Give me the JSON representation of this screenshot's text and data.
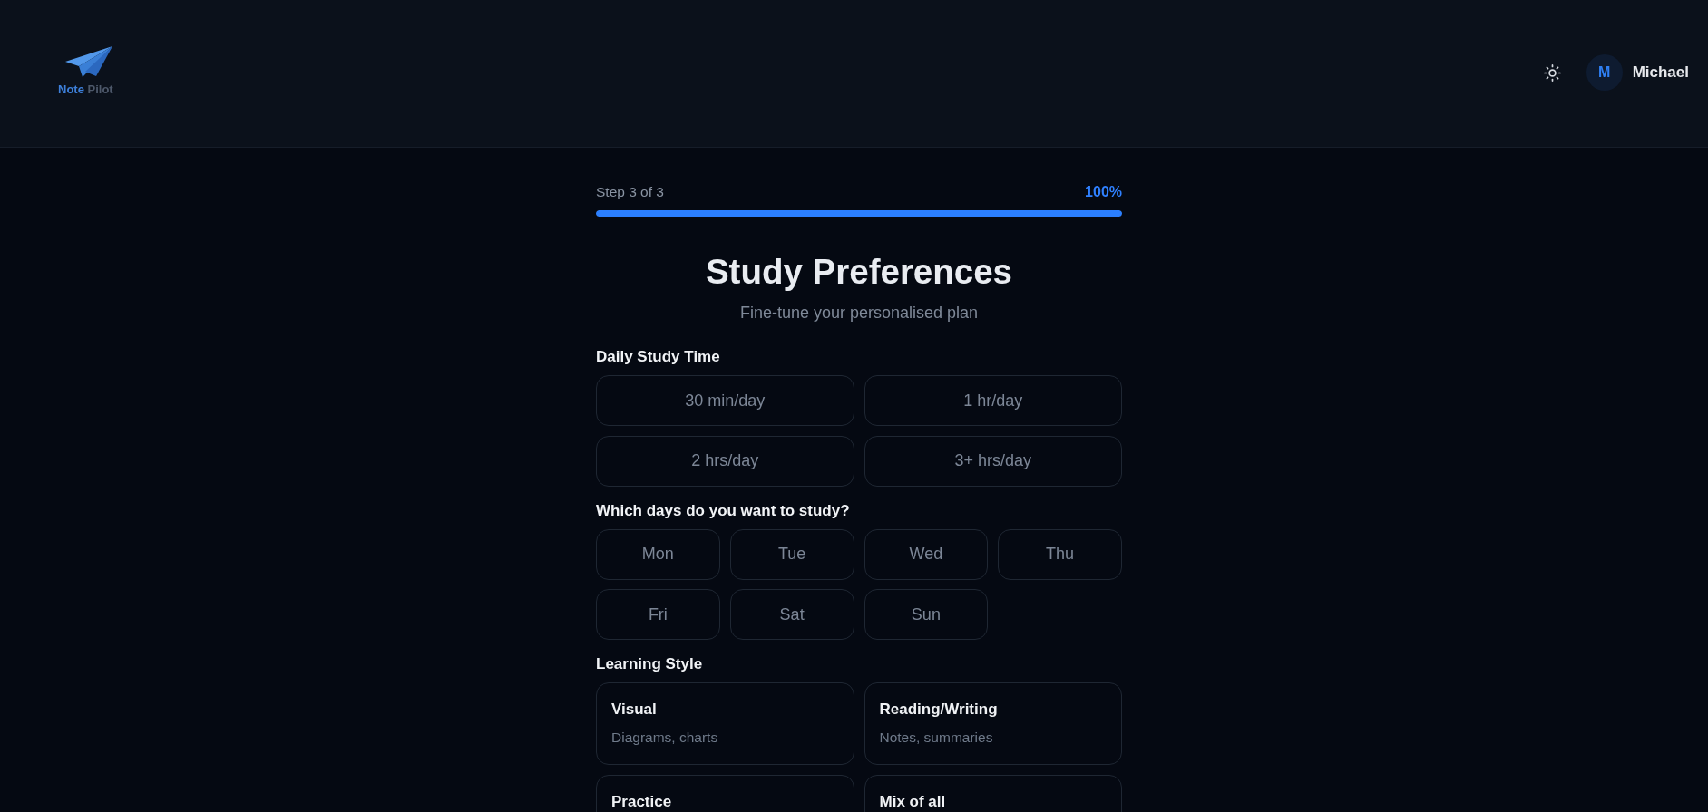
{
  "header": {
    "logo": {
      "primary": "Note",
      "secondary": "Pilot"
    },
    "user": {
      "initial": "M",
      "name": "Michael"
    }
  },
  "progress": {
    "label": "Step 3 of 3",
    "percent": "100%",
    "level": 1.0
  },
  "title": "Study Preferences",
  "subtitle": "Fine-tune your personalised plan",
  "sections": [
    {
      "kind": "time",
      "label": "Daily Study Time",
      "options": [
        {
          "label": "30 min/day",
          "selected": false
        },
        {
          "label": "1 hr/day",
          "selected": false
        },
        {
          "label": "2 hrs/day",
          "selected": false
        },
        {
          "label": "3+ hrs/day",
          "selected": false
        }
      ]
    },
    {
      "kind": "days",
      "label": "Which days do you want to study?",
      "options": [
        {
          "label": "Mon",
          "selected": false
        },
        {
          "label": "Tue",
          "selected": false
        },
        {
          "label": "Wed",
          "selected": false
        },
        {
          "label": "Thu",
          "selected": false
        },
        {
          "label": "Fri",
          "selected": false
        },
        {
          "label": "Sat",
          "selected": false
        },
        {
          "label": "Sun",
          "selected": false
        }
      ]
    },
    {
      "kind": "style",
      "label": "Learning Style",
      "options": [
        {
          "title": "Visual",
          "description": "Diagrams, charts",
          "selected": false
        },
        {
          "title": "Reading/Writing",
          "description": "Notes, summaries",
          "selected": false
        },
        {
          "title": "Practice",
          "selected": false
        },
        {
          "title": "Mix of all",
          "selected": false
        }
      ]
    }
  ]
}
